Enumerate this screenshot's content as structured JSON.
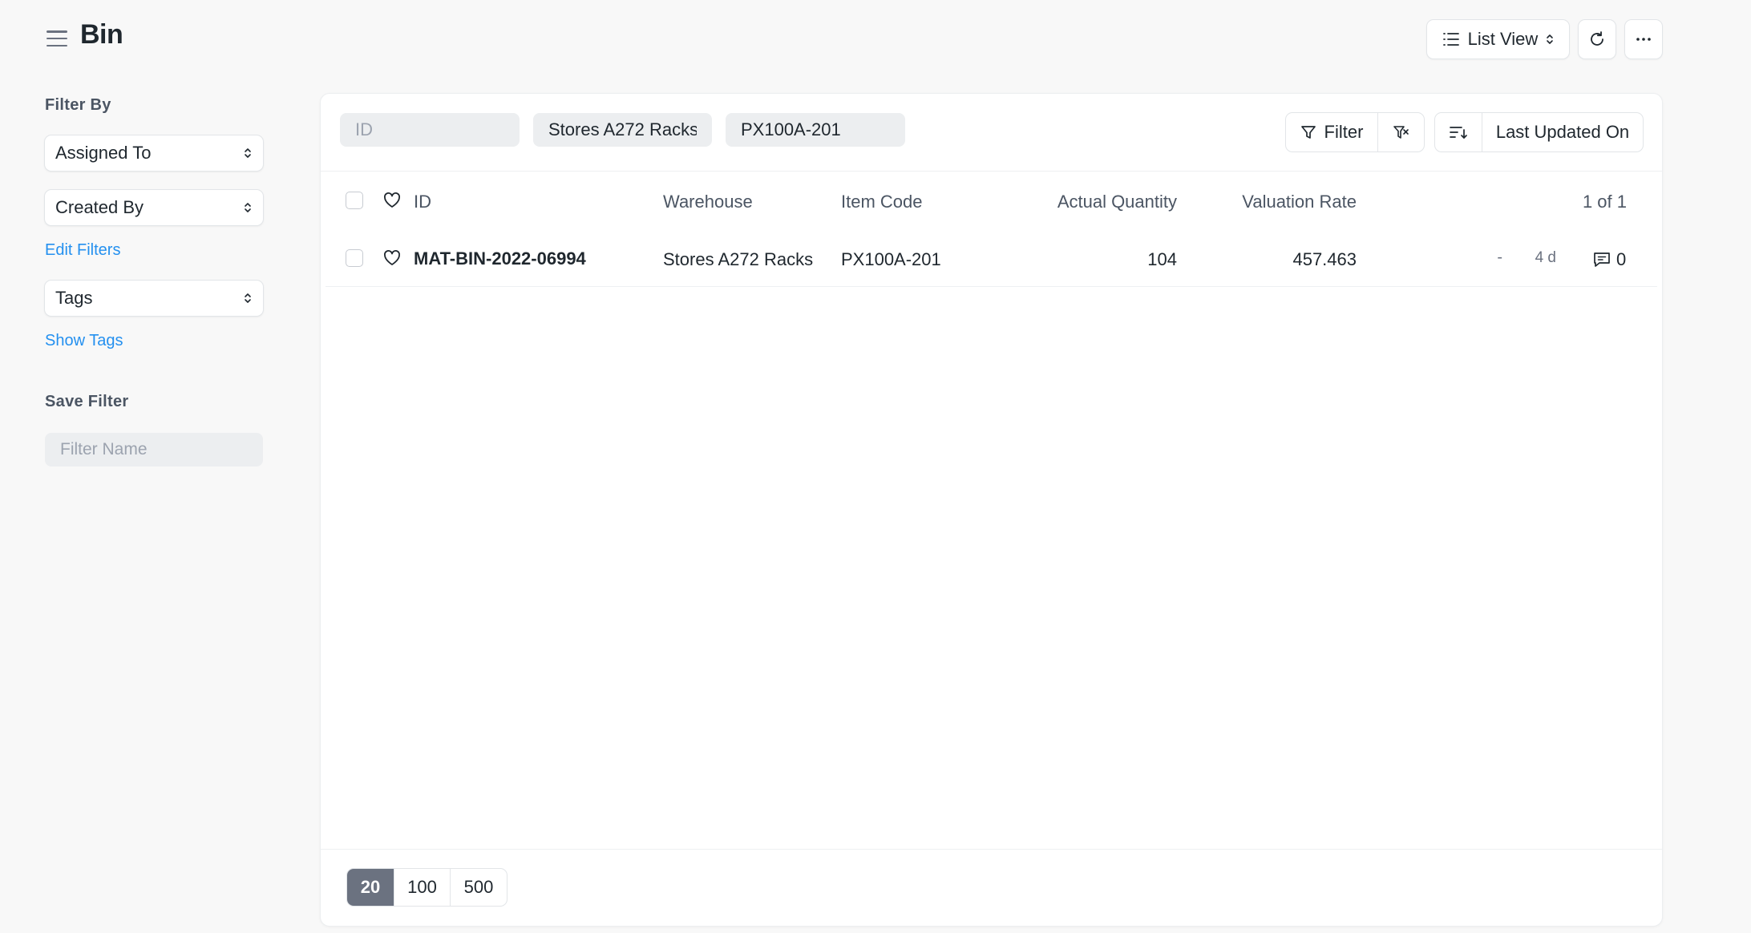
{
  "header": {
    "title": "Bin",
    "view_label": "List View"
  },
  "sidebar": {
    "filter_heading": "Filter By",
    "assigned_to": "Assigned To",
    "created_by": "Created By",
    "edit_filters": "Edit Filters",
    "tags": "Tags",
    "show_tags": "Show Tags",
    "save_heading": "Save Filter",
    "filter_name_placeholder": "Filter Name"
  },
  "toolbar": {
    "id_placeholder": "ID",
    "warehouse_value": "Stores A272 Racks",
    "item_code_value": "PX100A-201",
    "filter_label": "Filter",
    "sort_label": "Last Updated On"
  },
  "table": {
    "columns": [
      "ID",
      "Warehouse",
      "Item Code",
      "Actual Quantity",
      "Valuation Rate"
    ],
    "count": "1 of 1",
    "rows": [
      {
        "id": "MAT-BIN-2022-06994",
        "warehouse": "Stores A272 Racks",
        "item_code": "PX100A-201",
        "actual_quantity": "104",
        "valuation_rate": "457.463",
        "dash": "-",
        "modified": "4 d",
        "comments": "0"
      }
    ]
  },
  "pagination": {
    "sizes": [
      "20",
      "100",
      "500"
    ],
    "active": "20"
  }
}
